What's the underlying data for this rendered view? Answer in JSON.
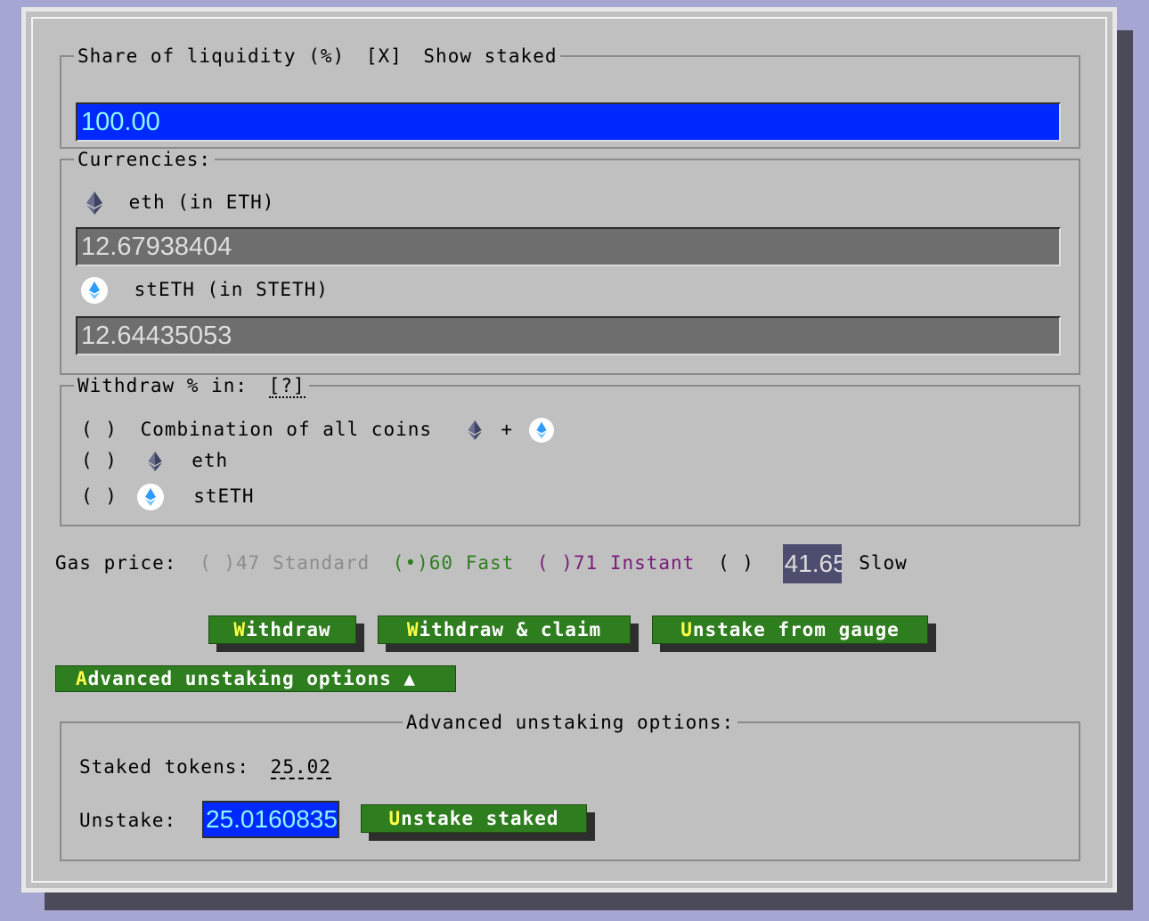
{
  "liquidity": {
    "legend_label": "Share of liquidity (%)",
    "show_staked_checkbox": "[X]",
    "show_staked_label": "Show staked",
    "value": "100.00"
  },
  "currencies": {
    "legend": "Currencies:",
    "items": [
      {
        "label": "eth (in ETH)",
        "value": "12.67938404",
        "icon": "eth-icon"
      },
      {
        "label": "stETH (in STETH)",
        "value": "12.64435053",
        "icon": "steth-icon"
      }
    ]
  },
  "withdraw_in": {
    "legend": "Withdraw % in:",
    "help": "[?]",
    "options": [
      {
        "radio": "( )",
        "label": "Combination of all coins",
        "plus": "+"
      },
      {
        "radio": "( )",
        "label": "eth"
      },
      {
        "radio": "( )",
        "label": "stETH"
      }
    ]
  },
  "gas": {
    "label": "Gas price:",
    "options": [
      {
        "radio": "( )",
        "value": "47",
        "name": "Standard",
        "color": "#8c8c8c"
      },
      {
        "radio": "(•)",
        "value": "60",
        "name": "Fast",
        "color": "#2e7d1e"
      },
      {
        "radio": "( )",
        "value": "71",
        "name": "Instant",
        "color": "#7a1a7a"
      },
      {
        "radio": "( )",
        "value": "41.65",
        "name": "Slow",
        "color": "#000000"
      }
    ]
  },
  "buttons": {
    "withdraw": {
      "hot": "W",
      "rest": "ithdraw"
    },
    "withdraw_claim": {
      "hot": "W",
      "rest": "ithdraw & claim"
    },
    "unstake_gauge": {
      "hot": "U",
      "rest": "nstake from gauge"
    },
    "advanced_toggle": {
      "hot": "A",
      "rest": "dvanced unstaking options ▲"
    },
    "unstake_staked": {
      "hot": "U",
      "rest": "nstake staked"
    }
  },
  "advanced": {
    "legend": "Advanced unstaking options:",
    "staked_label": "Staked tokens:",
    "staked_value": "25.02",
    "unstake_label": "Unstake:",
    "unstake_value": "25.0160835"
  },
  "colors": {
    "background": "#a6a6d2",
    "panel": "#c0c0c0",
    "button": "#2e7d1e",
    "hotkey": "#ffff4a",
    "input_blue": "#0029ff"
  }
}
